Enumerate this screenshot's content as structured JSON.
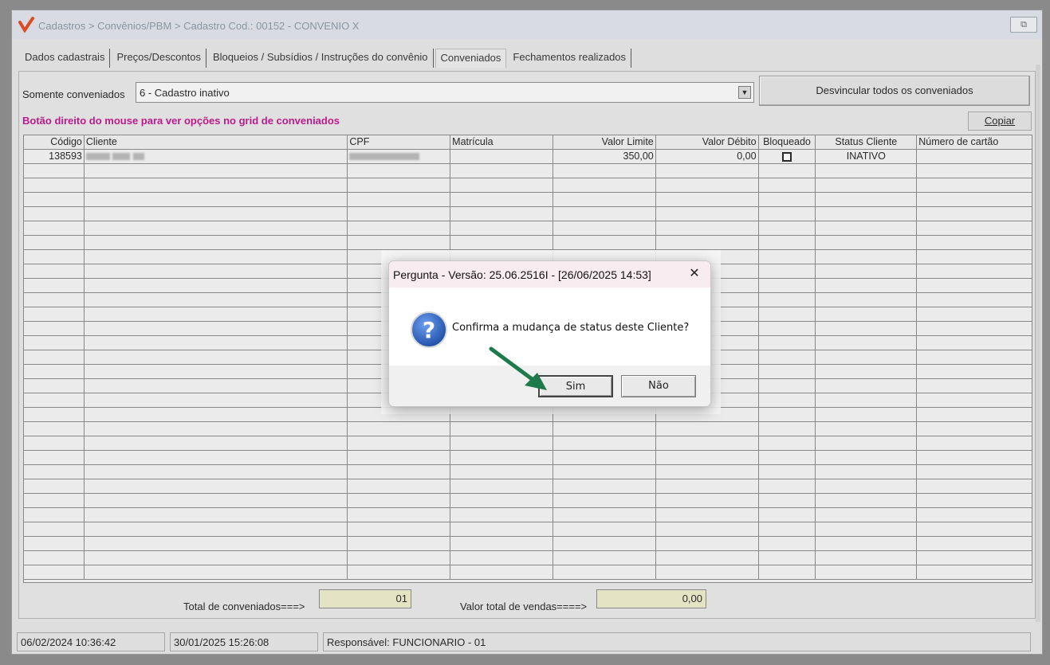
{
  "window": {
    "title": "Cadastros > Convênios/PBM > Cadastro  Cod.: 00152 - CONVENIO X",
    "restore_label": "⧉"
  },
  "tabs": [
    {
      "label": "Dados cadastrais"
    },
    {
      "label": "Preços/Descontos"
    },
    {
      "label": "Bloqueios / Subsídios / Instruções do convênio"
    },
    {
      "label": "Conveniados"
    },
    {
      "label": "Fechamentos realizados"
    }
  ],
  "filter": {
    "label": "Somente conveniados",
    "selected": "6 - Cadastro inativo"
  },
  "buttons": {
    "unlink_all": "Desvincular todos os conveniados",
    "copy": "Copiar"
  },
  "hint": "Botão direito do mouse para ver opções no grid de conveniados",
  "grid": {
    "headers": [
      "Código",
      "Cliente",
      "CPF",
      "Matrícula",
      "Valor Limite",
      "Valor Débito",
      "Bloqueado",
      "Status Cliente",
      "Número de cartão"
    ],
    "rows": [
      {
        "codigo": "138593",
        "cliente": "",
        "cpf": "",
        "matricula": "",
        "valor_limite": "350,00",
        "valor_debito": "0,00",
        "bloqueado": false,
        "status": "INATIVO",
        "cartao": ""
      }
    ]
  },
  "totals": {
    "conveniados_label": "Total de conveniados===>",
    "conveniados_value": "01",
    "vendas_label": "Valor total de vendas====>",
    "vendas_value": "0,00"
  },
  "statusbar": {
    "date1": "06/02/2024 10:36:42",
    "date2": "30/01/2025 15:26:08",
    "responsavel": "Responsável: FUNCIONARIO - 01"
  },
  "dialog": {
    "title": "Pergunta - Versão: 25.06.2516I - [26/06/2025 14:53]",
    "message": "Confirma a mudança de status deste Cliente?",
    "yes_label": "Sim",
    "no_label": "Não",
    "close_label": "✕"
  },
  "colors": {
    "hint": "#c0128a",
    "arrow": "#1e7a4a",
    "question_icon": "#2a5bb8"
  }
}
